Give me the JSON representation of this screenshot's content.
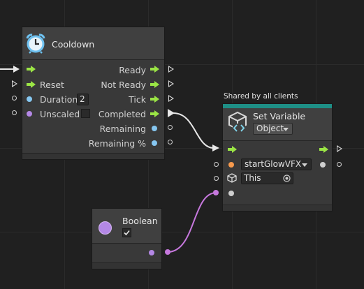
{
  "colors": {
    "flow": "#9be545",
    "number_port": "#86c7f1",
    "boolean_port": "#b488e6",
    "string_port": "#f79a4d",
    "teal_header": "#1e8f86",
    "wire_bool": "#c678dd",
    "wire_flow": "#ffffff"
  },
  "cooldown": {
    "title": "Cooldown",
    "icon": "alarm-clock-icon",
    "inputs": {
      "reset": "Reset",
      "duration": "Duration",
      "duration_value": "2",
      "unscaled": "Unscaled"
    },
    "outputs": {
      "ready": "Ready",
      "not_ready": "Not Ready",
      "tick": "Tick",
      "completed": "Completed",
      "remaining": "Remaining",
      "remaining_pct": "Remaining %"
    }
  },
  "set_variable": {
    "shared_label": "Shared by all clients",
    "title": "Set Variable",
    "icon": "cube-code-icon",
    "scope": "Object",
    "variable_name": "startGlowVFX",
    "target": "This",
    "target_icon": "cube-icon",
    "target_picker_icon": "target-circle-icon"
  },
  "boolean_node": {
    "title": "Boolean",
    "checked": true,
    "check_icon": "checkmark-icon"
  }
}
